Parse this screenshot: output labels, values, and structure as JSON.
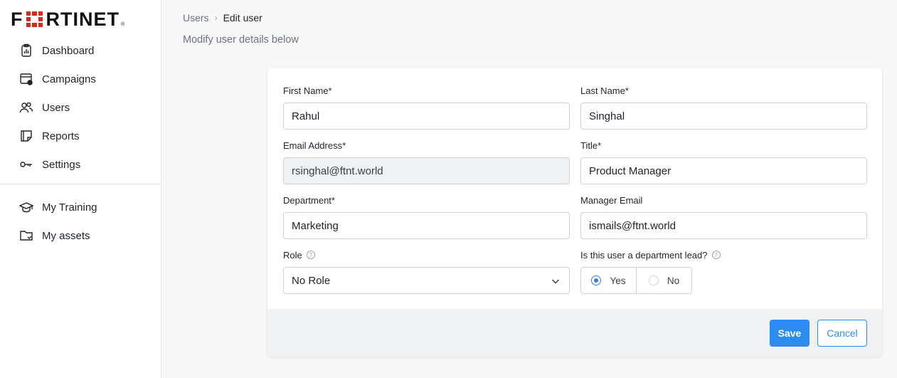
{
  "brand": {
    "logo_text_left": "F",
    "logo_text_right": "RTINET",
    "reg_mark": "®",
    "accent": "#da291c"
  },
  "sidebar": {
    "items": [
      {
        "label": "Dashboard",
        "icon": "clipboard-chart-icon"
      },
      {
        "label": "Campaigns",
        "icon": "browser-window-icon"
      },
      {
        "label": "Users",
        "icon": "users-icon"
      },
      {
        "label": "Reports",
        "icon": "report-note-icon"
      },
      {
        "label": "Settings",
        "icon": "key-icon"
      }
    ],
    "secondary": [
      {
        "label": "My Training",
        "icon": "graduation-cap-icon"
      },
      {
        "label": "My assets",
        "icon": "folder-check-icon"
      }
    ]
  },
  "breadcrumb": {
    "parent": "Users",
    "separator": "›",
    "current": "Edit user"
  },
  "page": {
    "subtitle": "Modify user details below"
  },
  "form": {
    "first_name": {
      "label": "First Name*",
      "value": "Rahul"
    },
    "last_name": {
      "label": "Last Name*",
      "value": "Singhal"
    },
    "email": {
      "label": "Email Address*",
      "value": "rsinghal@ftnt.world"
    },
    "title": {
      "label": "Title*",
      "value": "Product Manager"
    },
    "department": {
      "label": "Department*",
      "value": "Marketing"
    },
    "manager_email": {
      "label": "Manager Email",
      "value": "ismails@ftnt.world"
    },
    "role": {
      "label": "Role",
      "help": "?",
      "value": "No Role"
    },
    "dept_lead": {
      "label": "Is this user a department lead?",
      "help": "?",
      "yes": "Yes",
      "no": "No",
      "selected": "Yes"
    }
  },
  "actions": {
    "save": "Save",
    "cancel": "Cancel"
  },
  "colors": {
    "primary": "#2d8cf0",
    "radio": "#2b7de9"
  }
}
